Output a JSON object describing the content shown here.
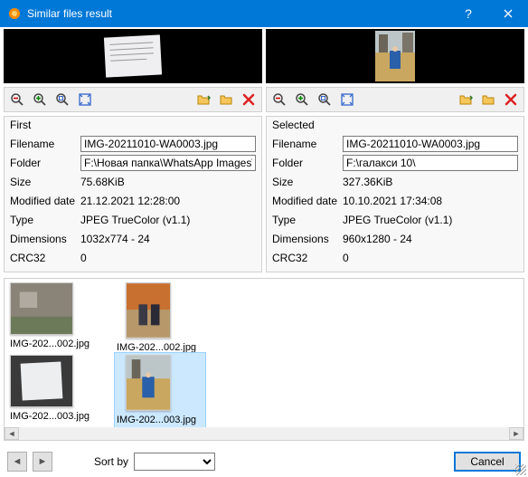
{
  "window": {
    "title": "Similar files result"
  },
  "panes": {
    "first": {
      "heading": "First",
      "filename_label": "Filename",
      "filename": "IMG-20211010-WA0003.jpg",
      "folder_label": "Folder",
      "folder": "F:\\Новая папка\\WhatsApp Images\\",
      "size_label": "Size",
      "size": "75.68KiB",
      "modified_label": "Modified date",
      "modified": "21.12.2021 12:28:00",
      "type_label": "Type",
      "type": "JPEG TrueColor (v1.1)",
      "dimensions_label": "Dimensions",
      "dimensions": "1032x774 - 24",
      "crc_label": "CRC32",
      "crc": "0"
    },
    "selected": {
      "heading": "Selected",
      "filename_label": "Filename",
      "filename": "IMG-20211010-WA0003.jpg",
      "folder_label": "Folder",
      "folder": "F:\\галакси 10\\",
      "size_label": "Size",
      "size": "327.36KiB",
      "modified_label": "Modified date",
      "modified": "10.10.2021 17:34:08",
      "type_label": "Type",
      "type": "JPEG TrueColor (v1.1)",
      "dimensions_label": "Dimensions",
      "dimensions": "960x1280 - 24",
      "crc_label": "CRC32",
      "crc": "0"
    }
  },
  "thumbs": {
    "t0": "IMG-202...002.jpg",
    "t1": "IMG-202...002.jpg",
    "t2": "IMG-202...003.jpg",
    "t3": "IMG-202...003.jpg"
  },
  "footer": {
    "sortby": "Sort by",
    "cancel": "Cancel"
  },
  "colors": {
    "accent": "#0078d7"
  }
}
